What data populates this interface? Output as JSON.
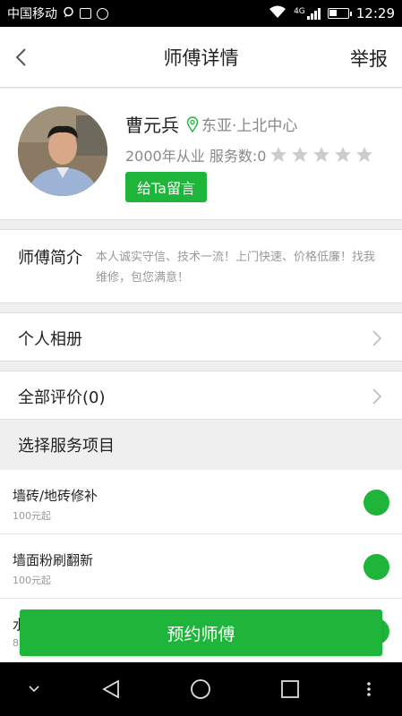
{
  "status_bar": {
    "carrier": "中国移动",
    "network": "4G",
    "time": "12:29",
    "icons": [
      "chat-bubble-icon",
      "image-icon",
      "blocked-icon",
      "wifi-icon",
      "signal-icon",
      "battery-icon"
    ]
  },
  "header": {
    "title": "师傅详情",
    "report_label": "举报",
    "back_icon": "chevron-left-icon"
  },
  "profile": {
    "name": "曹元兵",
    "location": "东亚·上北中心",
    "experience": "2000年从业",
    "service_count": "服务数:0",
    "rating": 0,
    "rating_max": 5,
    "message_button": "给Ta留言",
    "avatar_icon": "worker-avatar-photo"
  },
  "intro": {
    "label": "师傅简介",
    "text": "本人诚实守信、技术一流！上门快速、价格低廉！找我维修，包您满意！"
  },
  "album_row": {
    "label": "个人相册"
  },
  "reviews_row": {
    "label": "全部评价(0)"
  },
  "services_section": {
    "title": "选择服务项目",
    "items": [
      {
        "name": "墙砖/地砖修补",
        "price": "100元起",
        "selected": true
      },
      {
        "name": "墙面粉刷翻新",
        "price": "100元起",
        "selected": true
      },
      {
        "name": "水",
        "price": "8",
        "selected": true
      }
    ]
  },
  "book_button": {
    "label": "预约师傅"
  },
  "colors": {
    "accent": "#1fb53a",
    "secondary_text": "#999999",
    "star_empty": "#cccccc"
  },
  "nav_bar": {
    "buttons": [
      "chevron-down-icon",
      "back-triangle-icon",
      "home-circle-icon",
      "recents-square-icon",
      "more-dots-icon"
    ]
  }
}
